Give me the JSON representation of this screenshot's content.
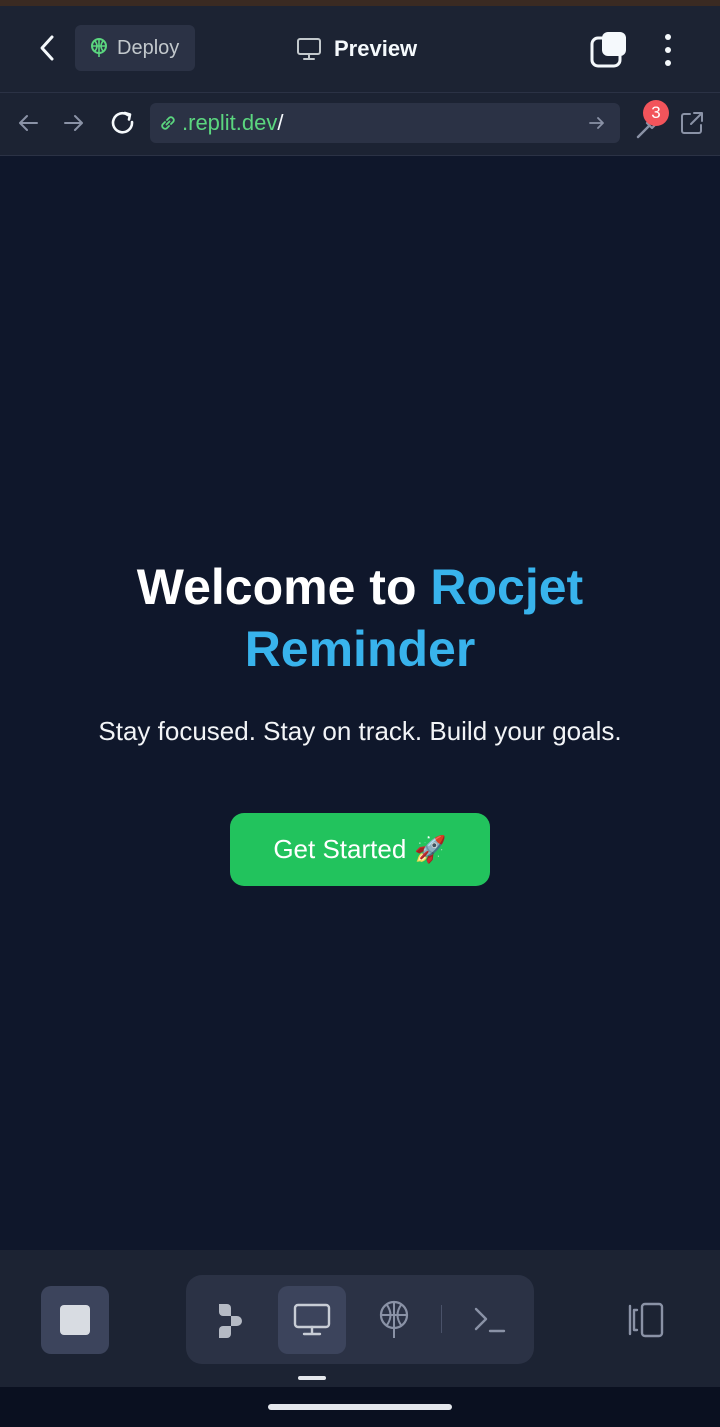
{
  "header": {
    "deploy_label": "Deploy",
    "title": "Preview"
  },
  "browser": {
    "url_host": ".replit.dev",
    "url_path": "/",
    "devtools_badge": "3"
  },
  "hero": {
    "title_plain": "Welcome to ",
    "title_accent_1": "Rocjet",
    "title_accent_2": "Reminder",
    "subtitle": "Stay focused. Stay on track. Build your goals.",
    "cta_label": "Get Started",
    "cta_emoji": "🚀"
  },
  "colors": {
    "page_bg": "#0f172b",
    "chrome_bg": "#1c2333",
    "accent_blue": "#38b3ec",
    "cta_green": "#22c35d",
    "url_green": "#5bd67f",
    "badge_red": "#f2545b"
  },
  "icons": {
    "back": "chevron-left-icon",
    "deploy": "deploy-icon",
    "preview": "monitor-icon",
    "tabs": "tabs-icon",
    "more": "more-vertical-icon",
    "nav_back": "arrow-left-icon",
    "nav_forward": "arrow-right-icon",
    "reload": "reload-icon",
    "link": "link-icon",
    "devtools": "devtools-icon",
    "open_external": "external-link-icon",
    "stop": "stop-icon",
    "agent": "agent-icon",
    "webview": "monitor-icon",
    "deployments": "deploy-icon",
    "shell": "terminal-icon",
    "split": "split-view-icon"
  }
}
